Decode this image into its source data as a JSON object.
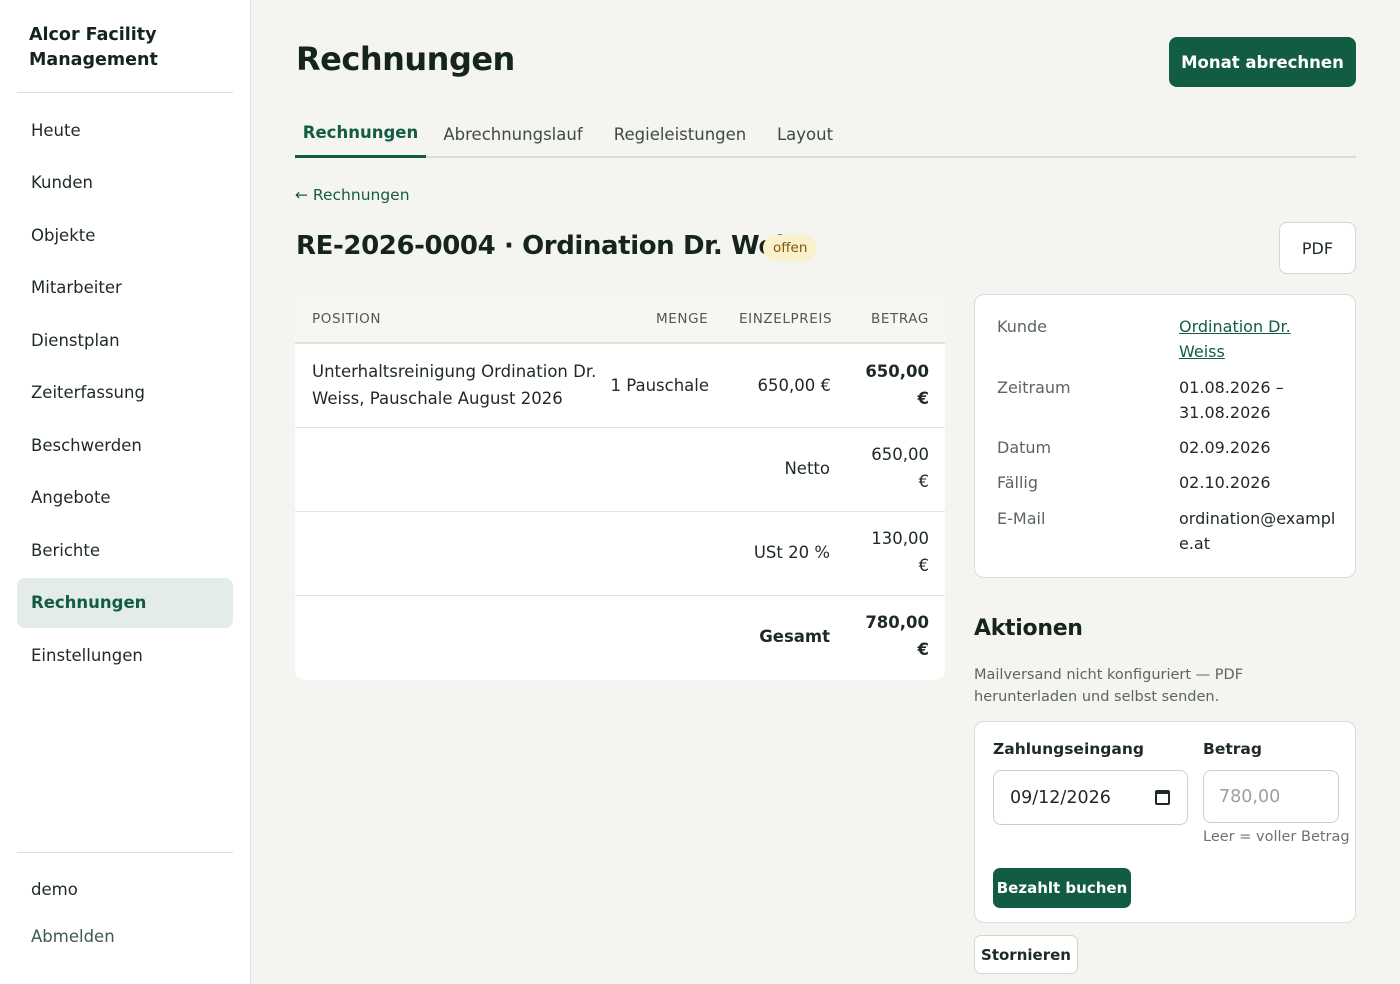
{
  "brand": {
    "line1": "Alcor Facility",
    "line2": "Management"
  },
  "sidebar": {
    "items": [
      {
        "label": "Heute"
      },
      {
        "label": "Kunden"
      },
      {
        "label": "Objekte"
      },
      {
        "label": "Mitarbeiter"
      },
      {
        "label": "Dienstplan"
      },
      {
        "label": "Zeiterfassung"
      },
      {
        "label": "Beschwerden"
      },
      {
        "label": "Angebote"
      },
      {
        "label": "Berichte"
      },
      {
        "label": "Rechnungen",
        "active": true
      },
      {
        "label": "Einstellungen"
      }
    ],
    "user": "demo",
    "logout": "Abmelden"
  },
  "header": {
    "title": "Rechnungen",
    "primary_button": "Monat abrechnen"
  },
  "tabs": [
    {
      "label": "Rechnungen",
      "active": true
    },
    {
      "label": "Abrechnungslauf"
    },
    {
      "label": "Regieleistungen"
    },
    {
      "label": "Layout"
    }
  ],
  "back_link": "← Rechnungen",
  "invoice": {
    "title": "RE-2026-0004 · Ordination Dr. Weiss",
    "status": "offen",
    "pdf_button": "PDF"
  },
  "table": {
    "headers": {
      "position": "POSITION",
      "menge": "MENGE",
      "einzelpreis": "EINZELPREIS",
      "betrag": "BETRAG"
    },
    "rows": [
      {
        "position_line1": "Unterhaltsreinigung Ordination Dr.",
        "position_line2": "Weiss, Pauschale August 2026",
        "menge": "1 Pauschale",
        "einzelpreis": "650,00 €",
        "betrag_line1": "650,00",
        "betrag_line2": "€"
      }
    ],
    "totals": [
      {
        "label": "Netto",
        "amount_line1": "650,00",
        "amount_line2": "€"
      },
      {
        "label": "USt 20 %",
        "amount_line1": "130,00",
        "amount_line2": "€"
      },
      {
        "label": "Gesamt",
        "amount_line1": "780,00",
        "amount_line2": "€"
      }
    ]
  },
  "details": {
    "kunde_label": "Kunde",
    "kunde_value": "Ordination Dr. Weiss",
    "zeitraum_label": "Zeitraum",
    "zeitraum_line1": "01.08.2026 –",
    "zeitraum_line2": "31.08.2026",
    "datum_label": "Datum",
    "datum_value": "02.09.2026",
    "faellig_label": "Fällig",
    "faellig_value": "02.10.2026",
    "email_label": "E-Mail",
    "email_value": "ordination@example.at"
  },
  "actions": {
    "title": "Aktionen",
    "note": "Mailversand nicht konfiguriert — PDF herunterladen und selbst senden.",
    "payment_label": "Zahlungseingang",
    "payment_date": "09/12/2026",
    "amount_label": "Betrag",
    "amount_placeholder": "780,00",
    "amount_hint": "Leer = voller Betrag",
    "paid_button": "Bezahlt buchen",
    "cancel_button": "Stornieren"
  }
}
